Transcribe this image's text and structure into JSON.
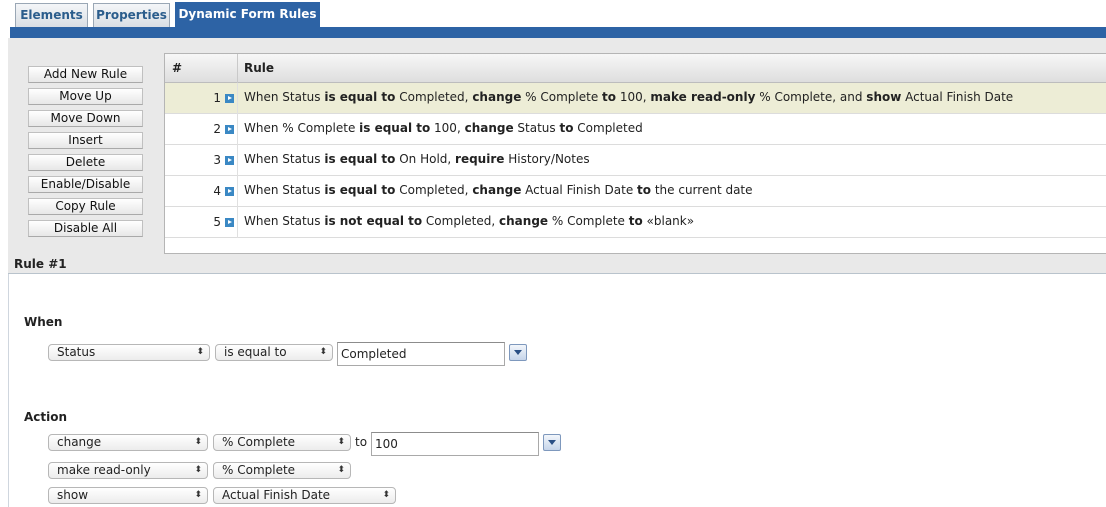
{
  "tabs": [
    {
      "label": "Elements",
      "active": false
    },
    {
      "label": "Properties",
      "active": false
    },
    {
      "label": "Dynamic Form Rules",
      "active": true
    }
  ],
  "buttons": {
    "add_new_rule": "Add New Rule",
    "move_up": "Move Up",
    "move_down": "Move Down",
    "insert": "Insert",
    "delete": "Delete",
    "enable_disable": "Enable/Disable",
    "copy_rule": "Copy Rule",
    "disable_all": "Disable All"
  },
  "grid": {
    "col_num": "#",
    "col_rule": "Rule",
    "selected_row": 1,
    "rows": [
      {
        "num": "1",
        "parts": [
          {
            "t": "When Status ",
            "b": false
          },
          {
            "t": "is equal to",
            "b": true
          },
          {
            "t": " Completed, ",
            "b": false
          },
          {
            "t": "change",
            "b": true
          },
          {
            "t": " % Complete ",
            "b": false
          },
          {
            "t": "to",
            "b": true
          },
          {
            "t": " 100, ",
            "b": false
          },
          {
            "t": "make read-only",
            "b": true
          },
          {
            "t": " % Complete, and ",
            "b": false
          },
          {
            "t": "show",
            "b": true
          },
          {
            "t": " Actual Finish Date",
            "b": false
          }
        ]
      },
      {
        "num": "2",
        "parts": [
          {
            "t": "When % Complete ",
            "b": false
          },
          {
            "t": "is equal to",
            "b": true
          },
          {
            "t": " 100, ",
            "b": false
          },
          {
            "t": "change",
            "b": true
          },
          {
            "t": " Status ",
            "b": false
          },
          {
            "t": "to",
            "b": true
          },
          {
            "t": " Completed",
            "b": false
          }
        ]
      },
      {
        "num": "3",
        "parts": [
          {
            "t": "When Status ",
            "b": false
          },
          {
            "t": "is equal to",
            "b": true
          },
          {
            "t": " On Hold, ",
            "b": false
          },
          {
            "t": "require",
            "b": true
          },
          {
            "t": " History/Notes",
            "b": false
          }
        ]
      },
      {
        "num": "4",
        "parts": [
          {
            "t": "When Status ",
            "b": false
          },
          {
            "t": "is equal to",
            "b": true
          },
          {
            "t": " Completed, ",
            "b": false
          },
          {
            "t": "change",
            "b": true
          },
          {
            "t": " Actual Finish Date ",
            "b": false
          },
          {
            "t": "to",
            "b": true
          },
          {
            "t": " the current date",
            "b": false
          }
        ]
      },
      {
        "num": "5",
        "parts": [
          {
            "t": "When Status ",
            "b": false
          },
          {
            "t": "is not equal to",
            "b": true
          },
          {
            "t": " Completed, ",
            "b": false
          },
          {
            "t": "change",
            "b": true
          },
          {
            "t": " % Complete ",
            "b": false
          },
          {
            "t": "to",
            "b": true
          },
          {
            "t": " «blank»",
            "b": false
          }
        ]
      }
    ]
  },
  "rule_detail": {
    "title": "Rule #1",
    "when_label": "When",
    "when": {
      "field": "Status",
      "operator": "is equal to",
      "value": "Completed"
    },
    "action_label": "Action",
    "actions": [
      {
        "verb": "change",
        "field": "% Complete",
        "to_label": "to",
        "value": "100"
      },
      {
        "verb": "make read-only",
        "field": "% Complete"
      },
      {
        "verb": "show",
        "field": "Actual Finish Date"
      }
    ]
  },
  "icons": {
    "row_arrow": "expand-arrow-icon",
    "select_caret": "updown-caret-icon",
    "dropdown_button": "chevron-down-icon"
  },
  "colors": {
    "accent": "#2d63a5",
    "selected_row": "#ededd6"
  }
}
